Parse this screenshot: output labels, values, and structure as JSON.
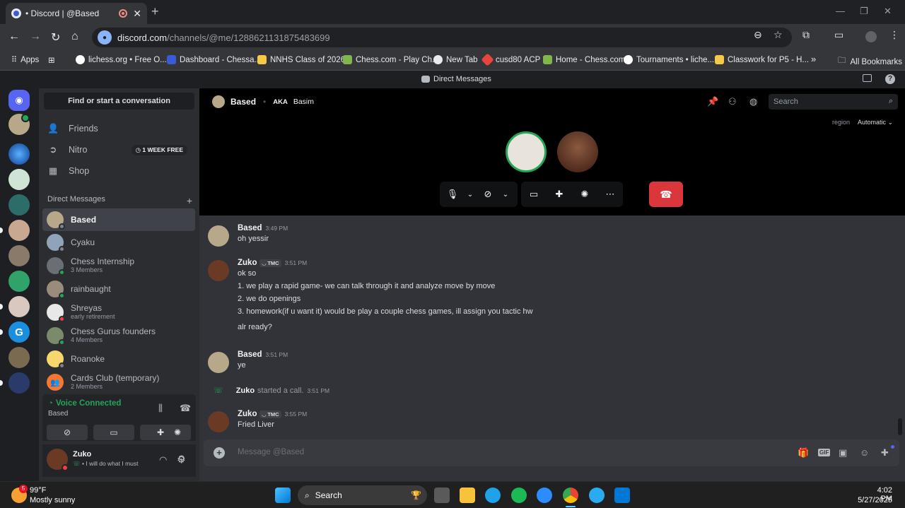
{
  "browser": {
    "tab_title": "• Discord | @Based",
    "new_tab_glyph": "+",
    "url_host": "discord.com",
    "url_path": "/channels/@me/1288621131875483699",
    "bookmarks": [
      {
        "label": "Apps",
        "color": "#e8eaed"
      },
      {
        "label": "lichess.org • Free O...",
        "color": "#ffffff"
      },
      {
        "label": "Dashboard - Chessa...",
        "color": "#3b5bd6"
      },
      {
        "label": "NNHS Class of 2026",
        "color": "#f7c948"
      },
      {
        "label": "Chess.com - Play Ch...",
        "color": "#81b64c"
      },
      {
        "label": "New Tab",
        "color": "#e8eaed"
      },
      {
        "label": "cusd80 ACP",
        "color": "#e8453c"
      },
      {
        "label": "Home - Chess.com",
        "color": "#81b64c"
      },
      {
        "label": "Tournaments • liche...",
        "color": "#ffffff"
      },
      {
        "label": "Classwork for P5 - H...",
        "color": "#f7c948"
      }
    ],
    "all_bookmarks": "All Bookmarks",
    "more": "»"
  },
  "app": {
    "title": "Direct Messages"
  },
  "sidebar": {
    "find": "Find or start a conversation",
    "nav": [
      {
        "label": "Friends",
        "icon": "👤"
      },
      {
        "label": "Nitro",
        "icon": "➲",
        "badge": "1 WEEK FREE"
      },
      {
        "label": "Shop",
        "icon": "▦"
      }
    ],
    "dm_header": "Direct Messages",
    "dms": [
      {
        "name": "Based",
        "sub": "",
        "color": "#b8a88a",
        "status": "#80848e",
        "active": true
      },
      {
        "name": "Cyaku",
        "sub": "",
        "color": "#8fa4b8",
        "status": "#80848e"
      },
      {
        "name": "Chess Internship",
        "sub": "3 Members",
        "color": "#6a6e75",
        "status": "#23a55a"
      },
      {
        "name": "rainbaught",
        "sub": "",
        "color": "#9a8c7a",
        "status": "#23a55a"
      },
      {
        "name": "Shreyas",
        "sub": "early retirement",
        "color": "#e8e8e8",
        "status": "#f23f43"
      },
      {
        "name": "Chess Gurus founders",
        "sub": "4 Members",
        "color": "#7a8a6a",
        "status": "#23a55a"
      },
      {
        "name": "Roanoke",
        "sub": "",
        "color": "#f5d76e",
        "status": "#80848e"
      },
      {
        "name": "Cards Club (temporary)",
        "sub": "2 Members",
        "color": "#f57731",
        "status": ""
      }
    ],
    "voice": {
      "status": "Voice Connected",
      "channel": "Based"
    },
    "user": {
      "name": "Zuko",
      "status": "• I will do what I must"
    }
  },
  "call": {
    "user": "Based",
    "aka_label": "AKA",
    "aka": "Basim",
    "search_placeholder": "Search",
    "region_label": "region",
    "region_value": "Automatic"
  },
  "messages": [
    {
      "author": "Based",
      "time": "3:49 PM",
      "tag": "",
      "lines": [
        "oh yessir"
      ],
      "color": "#b8a88a"
    },
    {
      "author": "Zuko",
      "time": "3:51 PM",
      "tag": "TMC",
      "lines": [
        "ok so",
        "1. we play a rapid game- we can talk through it and analyze move by move",
        "2. we do openings",
        "3. homework(if u want it) would be play a couple chess games, ill assign you tactic hw",
        "alr ready?"
      ],
      "color": "#6b3a25"
    },
    {
      "author": "Based",
      "time": "3:51 PM",
      "tag": "",
      "lines": [
        "ye"
      ],
      "color": "#b8a88a"
    },
    {
      "author": "Zuko",
      "time": "3:55 PM",
      "tag": "TMC",
      "lines": [
        "Fried Liver"
      ],
      "color": "#6b3a25"
    }
  ],
  "system_message": {
    "author": "Zuko",
    "text": "started a call.",
    "time": "3:51 PM"
  },
  "composer": {
    "placeholder": "Message @Based"
  },
  "taskbar": {
    "weather_temp": "99°F",
    "weather_desc": "Mostly sunny",
    "weather_badge": "5",
    "search": "Search",
    "time": "4:02 PM",
    "date": "5/27/2025"
  }
}
